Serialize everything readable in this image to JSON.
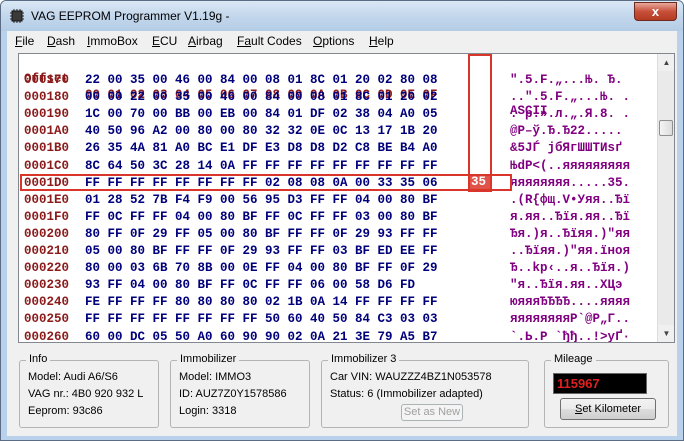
{
  "window": {
    "title": "VAG EEPROM Programmer  V1.19g -",
    "close_label": "x"
  },
  "menu": [
    {
      "label": "File",
      "u": "F",
      "rest": "ile"
    },
    {
      "label": "Dash",
      "u": "D",
      "rest": "ash"
    },
    {
      "label": "ImmoBox",
      "u": "I",
      "rest": "mmoBox"
    },
    {
      "label": "ECU",
      "u": "E",
      "rest": "CU"
    },
    {
      "label": "Airbag",
      "u": "A",
      "rest": "irbag"
    },
    {
      "label": "Fault Codes",
      "u": "Fa",
      "rest": "ult Codes"
    },
    {
      "label": "Options",
      "u": "O",
      "rest": "ptions"
    },
    {
      "label": "Help",
      "u": "H",
      "rest": "elp"
    }
  ],
  "hexview": {
    "header": {
      "addr": "Offset",
      "hex": "00 01 02 03 04 05 06 07 08 09 0A 0B 0C 0D 0E 0F",
      "ascii": "ASCII"
    },
    "rows": [
      {
        "addr": "000170",
        "hex": "22 00 35 00 46 00 84 00 08 01 8C 01 20 02 80 08",
        "ascii": "\".5.F.„...Њ. Ђ."
      },
      {
        "addr": "000180",
        "hex": "00 00 22 00 35 00 46 00 84 00 08 01 8C 01 20 02",
        "ascii": "..\".5.F.„...Њ. ."
      },
      {
        "addr": "000190",
        "hex": "1C 00 70 00 BB 00 EB 00 84 01 DF 02 38 04 A0 05",
        "ascii": ". p.».л.„.Я.8. ."
      },
      {
        "addr": "0001A0",
        "hex": "40 50 96 A2 00 80 00 80 32 32 0E 0C 13 17 1B 20",
        "ascii": "@P–ў.Ђ.Ђ22..... "
      },
      {
        "addr": "0001B0",
        "hex": "26 35 4A 81 A0 BC E1 DF E3 D8 D8 D2 C8 BE B4 A0",
        "ascii": "&5JЃ јбЯгШШТИѕґ "
      },
      {
        "addr": "0001C0",
        "hex": "8C 64 50 3C 28 14 0A FF FF FF FF FF FF FF FF FF",
        "ascii": "ЊdP<(..яяяяяяяяя"
      },
      {
        "addr": "0001D0",
        "hex": "FF FF FF FF FF FF FF FF 02 08 08 0A 00 33 35 06",
        "ascii": "яяяяяяяя.....35."
      },
      {
        "addr": "0001E0",
        "hex": "01 28 52 7B F4 F9 00 56 95 D3 FF FF 04 00 80 BF",
        "ascii": ".(R{фщ.V•Уяя..Ђї"
      },
      {
        "addr": "0001F0",
        "hex": "FF 0C FF FF 04 00 80 BF FF 0C FF FF 03 00 80 BF",
        "ascii": "я.яя..Ђїя.яя..Ђї"
      },
      {
        "addr": "000200",
        "hex": "80 FF 0F 29 FF 05 00 80 BF FF FF 0F 29 93 FF FF",
        "ascii": "Ђя.)я..Ђїяя.)\"яя"
      },
      {
        "addr": "000210",
        "hex": "05 00 80 BF FF FF 0F 29 93 FF FF 03 BF ED EE FF",
        "ascii": "..Ђїяя.)\"яя.їноя"
      },
      {
        "addr": "000220",
        "hex": "80 00 03 6B 70 8B 00 0E FF 04 00 80 BF FF 0F 29",
        "ascii": "Ђ..kp‹..я..Ђїя.)"
      },
      {
        "addr": "000230",
        "hex": "93 FF 04 00 80 BF FF 0C FF FF 06 00 58 D6 FD",
        "ascii": "\"я..Ђїя.яя..XЦэ"
      },
      {
        "addr": "000240",
        "hex": "FE FF FF FF 80 80 80 80 02 1B 0A 14 FF FF FF FF",
        "ascii": "юяяяЂЂЂЂ....яяяя"
      },
      {
        "addr": "000250",
        "hex": "FF FF FF FF FF FF FF FF 50 60 40 50 84 C3 03 03",
        "ascii": "яяяяяяяяP`@P„Г.."
      },
      {
        "addr": "000260",
        "hex": "60 00 DC 05 50 A0 60 90 90 02 0A 21 3E 79 A5 B7",
        "ascii": "`.Ь.P `ђђ..!>yҐ·"
      }
    ],
    "selected_value": "35"
  },
  "info": {
    "title": "Info",
    "model": "Model:   Audi A6/S6",
    "vag_nr": "VAG nr.: 4B0 920 932 L",
    "eeprom": "Eeprom: 93c86"
  },
  "immobilizer": {
    "title": "Immobilizer",
    "model": "Model:   IMMO3",
    "id": "ID: AUZ7Z0Y1578586",
    "login": "Login: 3318"
  },
  "immobilizer3": {
    "title": "Immobilizer 3",
    "vin": "Car VIN:  WAUZZZ4BZ1N053578",
    "status": "Status: 6 (Immobilizer adapted)",
    "set_as_new": "Set as New"
  },
  "mileage": {
    "title": "Mileage",
    "value": "115967",
    "set_button": "Set Kilometer",
    "set_button_u": "S",
    "set_button_rest": "et Kilometer"
  },
  "colors": {
    "accent": "#d9352b",
    "hex": "#00007b",
    "addr": "#8b1a1a",
    "ascii": "#800080",
    "mileage": "#e02020"
  }
}
